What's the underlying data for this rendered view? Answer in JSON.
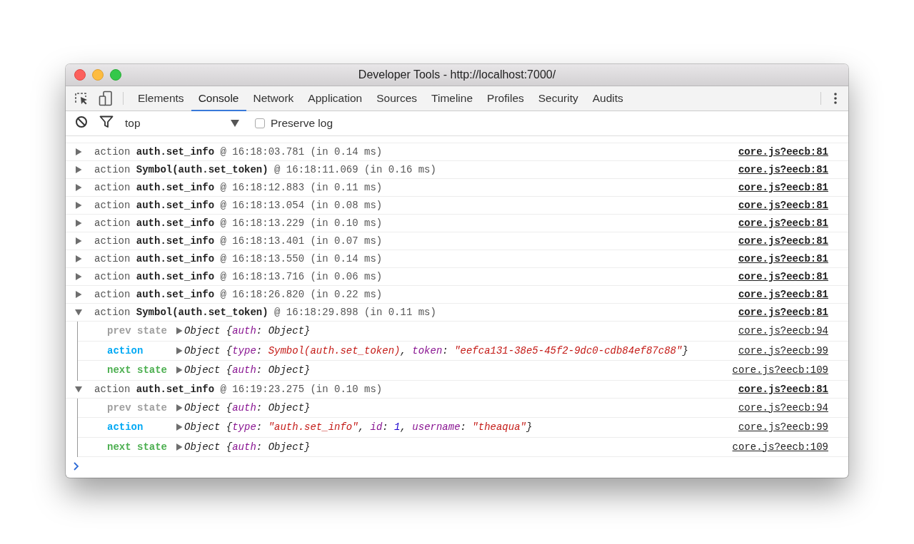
{
  "window": {
    "title": "Developer Tools - http://localhost:7000/"
  },
  "tabs": [
    {
      "label": "Elements",
      "selected": false
    },
    {
      "label": "Console",
      "selected": true
    },
    {
      "label": "Network",
      "selected": false
    },
    {
      "label": "Application",
      "selected": false
    },
    {
      "label": "Sources",
      "selected": false
    },
    {
      "label": "Timeline",
      "selected": false
    },
    {
      "label": "Profiles",
      "selected": false
    },
    {
      "label": "Security",
      "selected": false
    },
    {
      "label": "Audits",
      "selected": false
    }
  ],
  "toolbar": {
    "context": "top",
    "preserve_log": {
      "label": "Preserve log",
      "checked": false
    }
  },
  "entries": [
    {
      "text": "action **auth.set_info** @ 16:18:03.781 (in 0.14 ms)",
      "source": "core.js?eecb:81",
      "expanded": false
    },
    {
      "text": "action **Symbol(auth.set_token)** @ 16:18:11.069 (in 0.16 ms)",
      "source": "core.js?eecb:81",
      "expanded": false
    },
    {
      "text": "action **auth.set_info** @ 16:18:12.883 (in 0.11 ms)",
      "source": "core.js?eecb:81",
      "expanded": false
    },
    {
      "text": "action **auth.set_info** @ 16:18:13.054 (in 0.08 ms)",
      "source": "core.js?eecb:81",
      "expanded": false
    },
    {
      "text": "action **auth.set_info** @ 16:18:13.229 (in 0.10 ms)",
      "source": "core.js?eecb:81",
      "expanded": false
    },
    {
      "text": "action **auth.set_info** @ 16:18:13.401 (in 0.07 ms)",
      "source": "core.js?eecb:81",
      "expanded": false
    },
    {
      "text": "action **auth.set_info** @ 16:18:13.550 (in 0.14 ms)",
      "source": "core.js?eecb:81",
      "expanded": false
    },
    {
      "text": "action **auth.set_info** @ 16:18:13.716 (in 0.06 ms)",
      "source": "core.js?eecb:81",
      "expanded": false
    },
    {
      "text": "action **auth.set_info** @ 16:18:26.820 (in 0.22 ms)",
      "source": "core.js?eecb:81",
      "expanded": false
    },
    {
      "text": "action **Symbol(auth.set_token)** @ 16:18:29.898 (in 0.11 ms)",
      "source": "core.js?eecb:81",
      "expanded": true,
      "children": [
        {
          "kind": "prev",
          "label": "prev state",
          "source": "core.js?eecb:94",
          "segments": [
            {
              "kind": "plain",
              "text": "Object {"
            },
            {
              "kind": "key",
              "text": "auth"
            },
            {
              "kind": "plain",
              "text": ": Object}"
            }
          ]
        },
        {
          "kind": "action",
          "label": "action",
          "source": "core.js?eecb:99",
          "segments": [
            {
              "kind": "plain",
              "text": "Object {"
            },
            {
              "kind": "key",
              "text": "type"
            },
            {
              "kind": "plain",
              "text": ": "
            },
            {
              "kind": "string",
              "text": "Symbol(auth.set_token)"
            },
            {
              "kind": "plain",
              "text": ", "
            },
            {
              "kind": "key",
              "text": "token"
            },
            {
              "kind": "plain",
              "text": ": "
            },
            {
              "kind": "string",
              "text": "\"eefca131-38e5-45f2-9dc0-cdb84ef87c88\""
            },
            {
              "kind": "plain",
              "text": "}"
            }
          ]
        },
        {
          "kind": "next",
          "label": "next state",
          "source": "core.js?eecb:109",
          "segments": [
            {
              "kind": "plain",
              "text": "Object {"
            },
            {
              "kind": "key",
              "text": "auth"
            },
            {
              "kind": "plain",
              "text": ": Object}"
            }
          ]
        }
      ]
    },
    {
      "text": "action **auth.set_info** @ 16:19:23.275 (in 0.10 ms)",
      "source": "core.js?eecb:81",
      "expanded": true,
      "children": [
        {
          "kind": "prev",
          "label": "prev state",
          "source": "core.js?eecb:94",
          "segments": [
            {
              "kind": "plain",
              "text": "Object {"
            },
            {
              "kind": "key",
              "text": "auth"
            },
            {
              "kind": "plain",
              "text": ": Object}"
            }
          ]
        },
        {
          "kind": "action",
          "label": "action",
          "source": "core.js?eecb:99",
          "segments": [
            {
              "kind": "plain",
              "text": "Object {"
            },
            {
              "kind": "key",
              "text": "type"
            },
            {
              "kind": "plain",
              "text": ": "
            },
            {
              "kind": "string",
              "text": "\"auth.set_info\""
            },
            {
              "kind": "plain",
              "text": ", "
            },
            {
              "kind": "key",
              "text": "id"
            },
            {
              "kind": "plain",
              "text": ": "
            },
            {
              "kind": "number",
              "text": "1"
            },
            {
              "kind": "plain",
              "text": ", "
            },
            {
              "kind": "key",
              "text": "username"
            },
            {
              "kind": "plain",
              "text": ": "
            },
            {
              "kind": "string",
              "text": "\"theaqua\""
            },
            {
              "kind": "plain",
              "text": "}"
            }
          ]
        },
        {
          "kind": "next",
          "label": "next state",
          "source": "core.js?eecb:109",
          "segments": [
            {
              "kind": "plain",
              "text": "Object {"
            },
            {
              "kind": "key",
              "text": "auth"
            },
            {
              "kind": "plain",
              "text": ": Object}"
            }
          ]
        }
      ]
    }
  ]
}
